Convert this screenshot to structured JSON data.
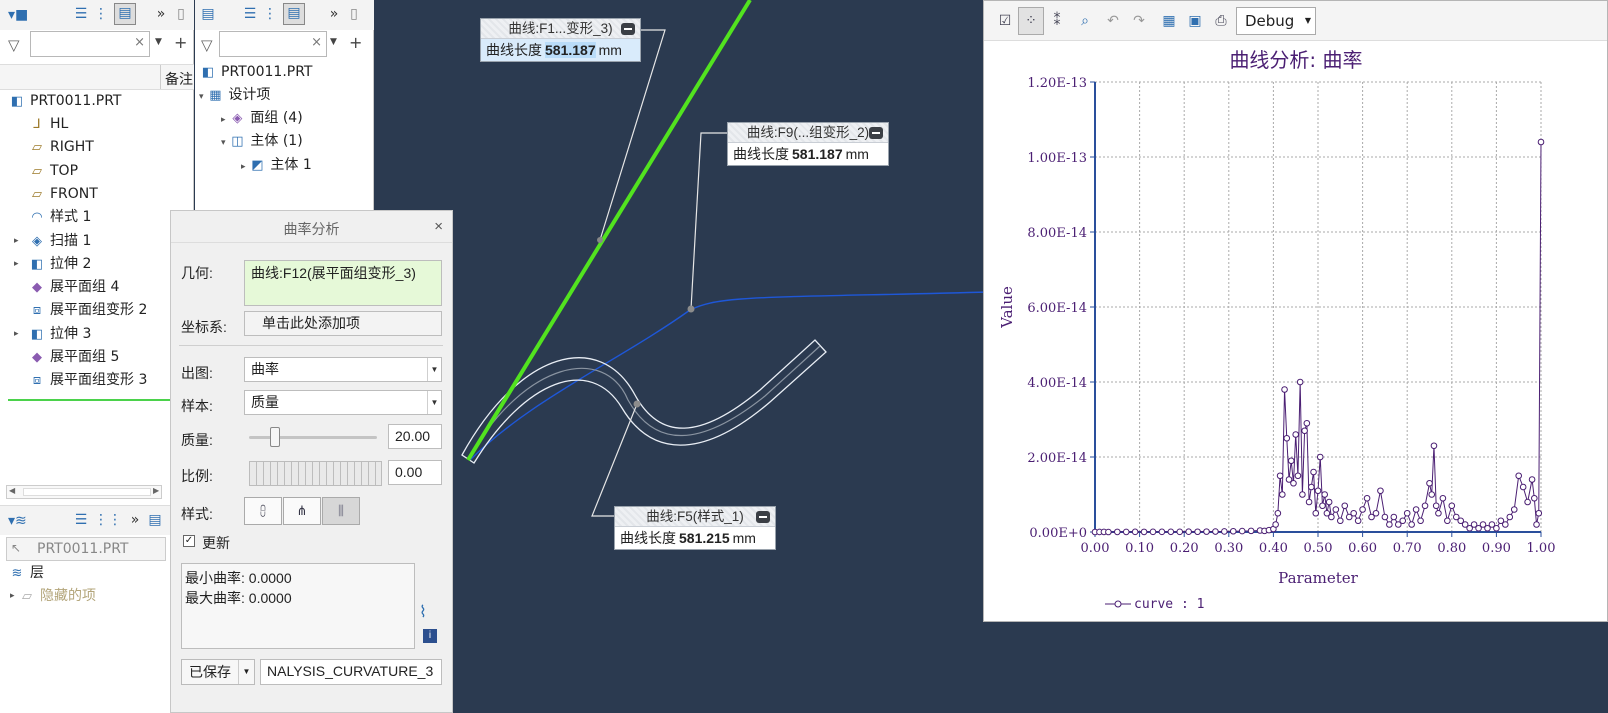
{
  "left_panel": {
    "tree_column_header": "备注",
    "root": "PRT0011.PRT",
    "items": [
      {
        "label": "HL",
        "icon": "csys-icon"
      },
      {
        "label": "RIGHT",
        "icon": "datum-plane-icon"
      },
      {
        "label": "TOP",
        "icon": "datum-plane-icon"
      },
      {
        "label": "FRONT",
        "icon": "datum-plane-icon"
      },
      {
        "label": "样式 1",
        "icon": "style-icon"
      },
      {
        "label": "扫描 1",
        "icon": "sweep-icon"
      },
      {
        "label": "拉伸 2",
        "icon": "extrude-icon"
      },
      {
        "label": "展平面组 4",
        "icon": "flatten-quilt-icon"
      },
      {
        "label": "展平面组变形 2",
        "icon": "flatten-deform-icon"
      },
      {
        "label": "拉伸 3",
        "icon": "extrude-icon"
      },
      {
        "label": "展平面组 5",
        "icon": "flatten-quilt-icon"
      },
      {
        "label": "展平面组变形 3",
        "icon": "flatten-deform-icon"
      }
    ],
    "layer_filter": "PRT0011.PRT",
    "layer_title": "层",
    "hidden_items": "隐藏的项"
  },
  "mid_panel": {
    "root": "PRT0011.PRT",
    "design_items": "设计项",
    "quilts": "面组 (4)",
    "bodies": "主体 (1)",
    "body1": "主体 1"
  },
  "callouts": [
    {
      "title": "曲线:F1...变形_3)",
      "label": "曲线长度",
      "value": "581.187",
      "unit": "mm"
    },
    {
      "title": "曲线:F9(...组变形_2)",
      "label": "曲线长度",
      "value": "581.187",
      "unit": "mm"
    },
    {
      "title": "曲线:F5(样式_1)",
      "label": "曲线长度",
      "value": "581.215",
      "unit": "mm"
    }
  ],
  "dialog": {
    "title": "曲率分析",
    "geometry_label": "几何:",
    "geometry_value": "曲线:F12(展平面组变形_3)",
    "csys_label": "坐标系:",
    "csys_value": "单击此处添加项",
    "plot_label": "出图:",
    "plot_value": "曲率",
    "sample_label": "样本:",
    "sample_value": "质量",
    "quality_label": "质量:",
    "quality_value": "20.00",
    "quality_fraction": 0.2,
    "scale_label": "比例:",
    "scale_value": "0.00",
    "style_label": "样式:",
    "update_label": "更新",
    "min_curvature": "最小曲率: 0.0000",
    "max_curvature": "最大曲率: 0.0000",
    "saved_label": "已保存",
    "name_value": "NALYSIS_CURVATURE_3"
  },
  "graph": {
    "dropdown": "Debug",
    "title": "曲线分析: 曲率",
    "legend": "curve : 1",
    "color": "#4b1f73"
  },
  "chart_data": {
    "type": "line",
    "title": "曲线分析: 曲率",
    "xlabel": "Parameter",
    "ylabel": "Value",
    "xlim": [
      0,
      1
    ],
    "ylim": [
      0,
      1.2e-13
    ],
    "x_ticks": [
      "0.00",
      "0.10",
      "0.20",
      "0.30",
      "0.40",
      "0.50",
      "0.60",
      "0.70",
      "0.80",
      "0.90",
      "1.00"
    ],
    "y_ticks": [
      "0.00E+0",
      "2.00E-14",
      "4.00E-14",
      "6.00E-14",
      "8.00E-14",
      "1.00E-13",
      "1.20E-13"
    ],
    "series": [
      {
        "name": "curve : 1",
        "x": [
          0,
          0.01,
          0.02,
          0.03,
          0.05,
          0.07,
          0.09,
          0.11,
          0.13,
          0.15,
          0.17,
          0.19,
          0.21,
          0.23,
          0.25,
          0.27,
          0.29,
          0.31,
          0.33,
          0.35,
          0.37,
          0.38,
          0.39,
          0.4,
          0.405,
          0.41,
          0.415,
          0.42,
          0.425,
          0.43,
          0.435,
          0.44,
          0.445,
          0.45,
          0.455,
          0.46,
          0.465,
          0.47,
          0.475,
          0.48,
          0.485,
          0.49,
          0.495,
          0.5,
          0.505,
          0.51,
          0.515,
          0.52,
          0.525,
          0.53,
          0.54,
          0.55,
          0.56,
          0.57,
          0.58,
          0.59,
          0.6,
          0.61,
          0.62,
          0.63,
          0.64,
          0.65,
          0.66,
          0.67,
          0.68,
          0.69,
          0.7,
          0.71,
          0.72,
          0.73,
          0.74,
          0.75,
          0.755,
          0.76,
          0.765,
          0.77,
          0.78,
          0.79,
          0.8,
          0.81,
          0.82,
          0.83,
          0.84,
          0.85,
          0.86,
          0.87,
          0.88,
          0.89,
          0.9,
          0.91,
          0.92,
          0.93,
          0.94,
          0.95,
          0.96,
          0.97,
          0.98,
          0.985,
          0.99,
          0.995,
          1.0
        ],
        "y": [
          0,
          1e-17,
          2e-17,
          0,
          3e-17,
          2e-17,
          4e-17,
          3e-17,
          5e-17,
          4e-17,
          6e-17,
          5e-17,
          8e-17,
          7e-17,
          1e-16,
          1.2e-16,
          1.5e-16,
          2e-16,
          2.5e-16,
          3e-16,
          4e-16,
          3e-16,
          5e-16,
          8e-16,
          2e-15,
          5e-15,
          1.5e-14,
          1e-14,
          3.8e-14,
          2.5e-14,
          1.4e-14,
          1.9e-14,
          1.3e-14,
          2.6e-14,
          1.5e-14,
          4e-14,
          1e-14,
          2.7e-14,
          2.9e-14,
          8e-15,
          1.2e-14,
          1.6e-14,
          5e-15,
          1.1e-14,
          2e-14,
          7e-15,
          1e-14,
          5e-15,
          8e-15,
          4e-15,
          6e-15,
          3e-15,
          7e-15,
          4e-15,
          5e-15,
          3e-15,
          6e-15,
          9e-15,
          4e-15,
          5e-15,
          1.1e-14,
          4e-15,
          2e-15,
          4e-15,
          2e-15,
          3e-15,
          5e-15,
          2e-15,
          6e-15,
          3e-15,
          7e-15,
          1.3e-14,
          1e-14,
          2.3e-14,
          7e-15,
          5e-15,
          9e-15,
          3e-15,
          7e-15,
          4e-15,
          3e-15,
          2e-15,
          1e-15,
          2e-15,
          1e-15,
          2e-15,
          1e-15,
          2e-15,
          1e-15,
          3e-15,
          2e-15,
          4e-15,
          6e-15,
          1.5e-14,
          1.2e-14,
          8e-15,
          1.4e-14,
          9e-15,
          2e-15,
          5e-15,
          1.04e-13
        ]
      }
    ],
    "grid": true,
    "legend_position": "bottom-left"
  }
}
